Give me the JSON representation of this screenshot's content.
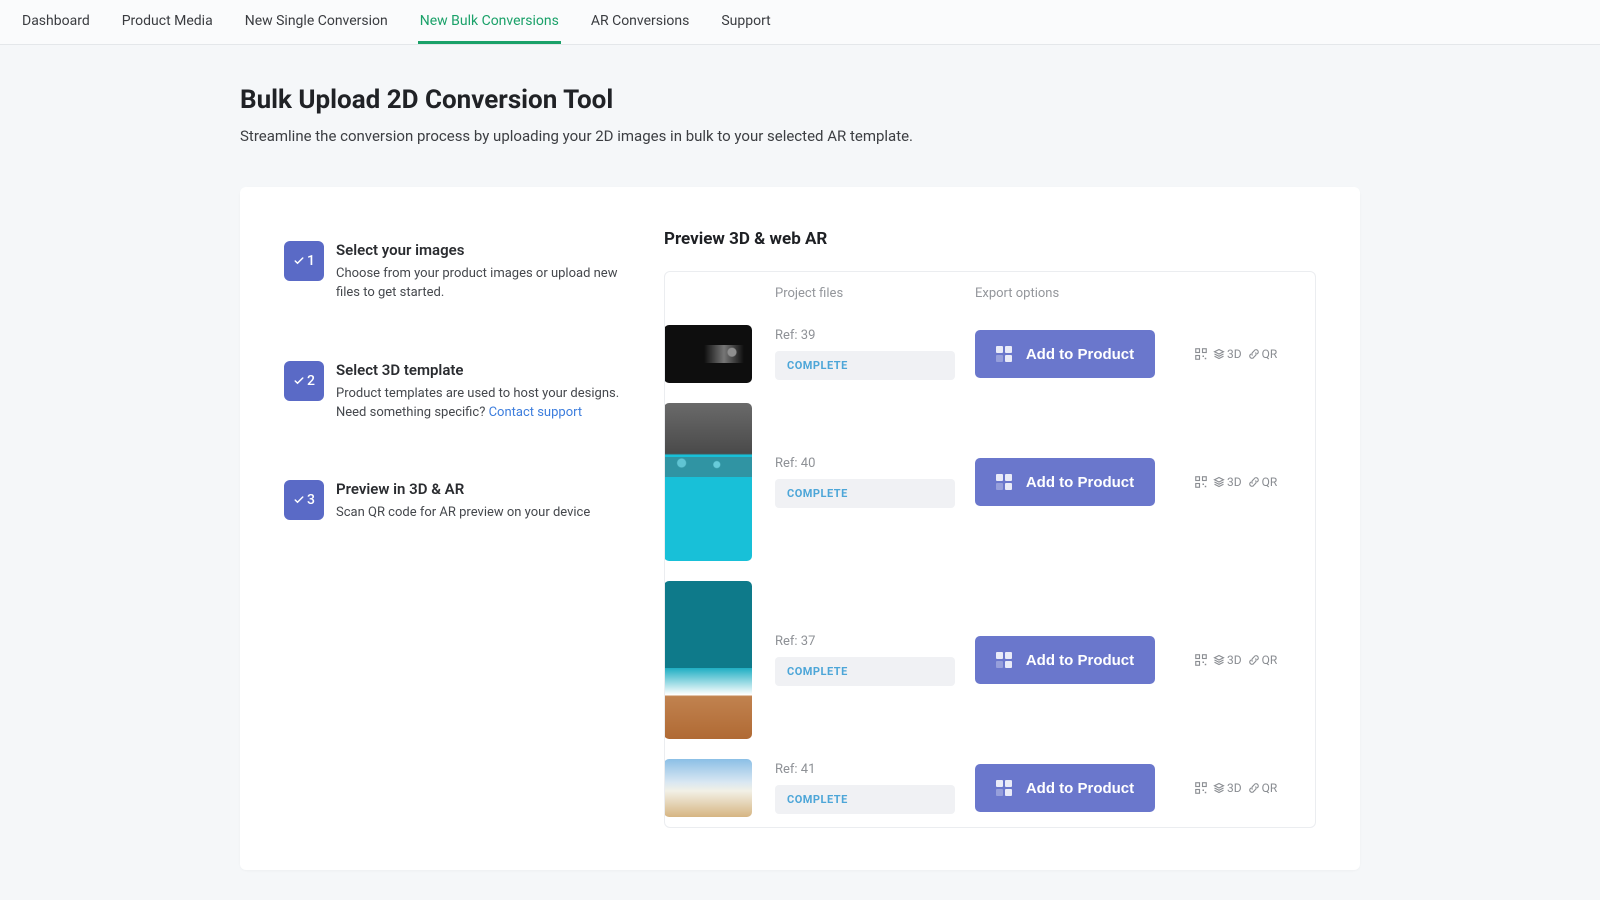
{
  "nav": {
    "items": [
      {
        "label": "Dashboard",
        "active": false
      },
      {
        "label": "Product Media",
        "active": false
      },
      {
        "label": "New Single Conversion",
        "active": false
      },
      {
        "label": "New Bulk Conversions",
        "active": true
      },
      {
        "label": "AR Conversions",
        "active": false
      },
      {
        "label": "Support",
        "active": false
      }
    ]
  },
  "header": {
    "title": "Bulk Upload 2D Conversion Tool",
    "subtitle": "Streamline the conversion process by uploading your 2D images in bulk to your selected AR template."
  },
  "steps": [
    {
      "num": "1",
      "title": "Select your images",
      "desc": "Choose from your product images or upload new files to get started.",
      "link": null
    },
    {
      "num": "2",
      "title": "Select 3D template",
      "desc": "Product templates are used to host your designs. Need something specific? ",
      "link": "Contact support"
    },
    {
      "num": "3",
      "title": "Preview in 3D & AR",
      "desc": "Scan QR code for AR preview on your device",
      "link": null
    }
  ],
  "preview": {
    "heading": "Preview 3D & web AR",
    "col_project": "Project files",
    "col_export": "Export options",
    "add_label": "Add to Product",
    "export_3d": "3D",
    "export_qr": "QR",
    "rows": [
      {
        "ref": "Ref: 39",
        "status": "COMPLETE",
        "thumb": "t0"
      },
      {
        "ref": "Ref: 40",
        "status": "COMPLETE",
        "thumb": "t1"
      },
      {
        "ref": "Ref: 37",
        "status": "COMPLETE",
        "thumb": "t2"
      },
      {
        "ref": "Ref: 41",
        "status": "COMPLETE",
        "thumb": "t3"
      }
    ]
  }
}
